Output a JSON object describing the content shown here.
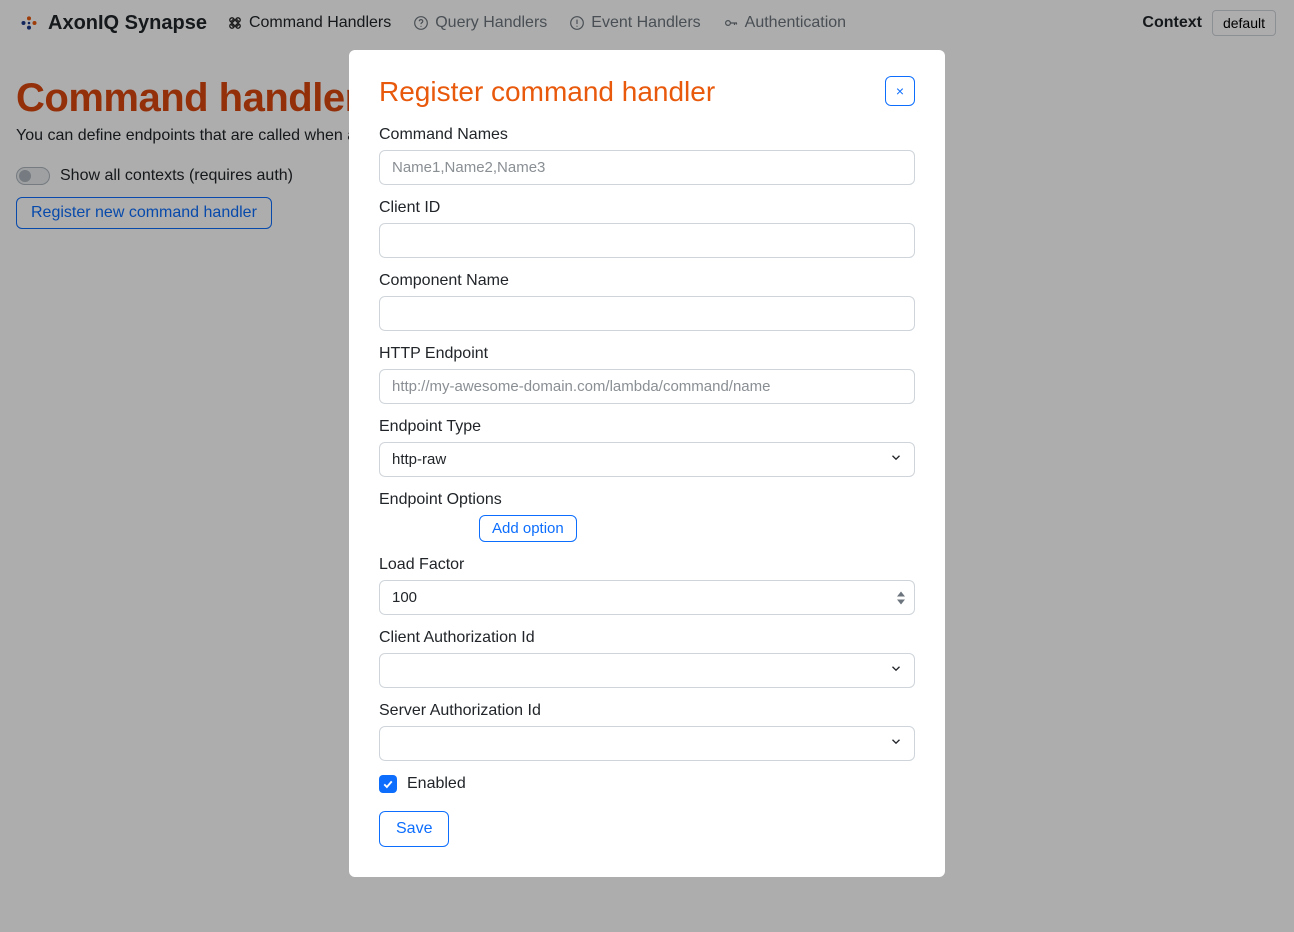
{
  "brand": {
    "name": "AxonIQ Synapse"
  },
  "nav": {
    "items": [
      {
        "label": "Command Handlers",
        "active": true
      },
      {
        "label": "Query Handlers",
        "active": false
      },
      {
        "label": "Event Handlers",
        "active": false
      },
      {
        "label": "Authentication",
        "active": false
      }
    ]
  },
  "context": {
    "label": "Context",
    "value": "default"
  },
  "page": {
    "title": "Command handlers",
    "subtitle": "You can define endpoints that are called when a c",
    "toggle_label": "Show all contexts (requires auth)",
    "register_btn": "Register new command handler"
  },
  "modal": {
    "title": "Register command handler",
    "close": "×",
    "fields": {
      "command_names": {
        "label": "Command Names",
        "placeholder": "Name1,Name2,Name3",
        "value": ""
      },
      "client_id": {
        "label": "Client ID",
        "value": ""
      },
      "component_name": {
        "label": "Component Name",
        "value": ""
      },
      "http_endpoint": {
        "label": "HTTP Endpoint",
        "placeholder": "http://my-awesome-domain.com/lambda/command/name",
        "value": ""
      },
      "endpoint_type": {
        "label": "Endpoint Type",
        "value": "http-raw"
      },
      "endpoint_options": {
        "label": "Endpoint Options",
        "add_btn": "Add option"
      },
      "load_factor": {
        "label": "Load Factor",
        "value": "100"
      },
      "client_auth": {
        "label": "Client Authorization Id",
        "value": ""
      },
      "server_auth": {
        "label": "Server Authorization Id",
        "value": ""
      },
      "enabled": {
        "label": "Enabled",
        "checked": true
      }
    },
    "save_btn": "Save"
  }
}
